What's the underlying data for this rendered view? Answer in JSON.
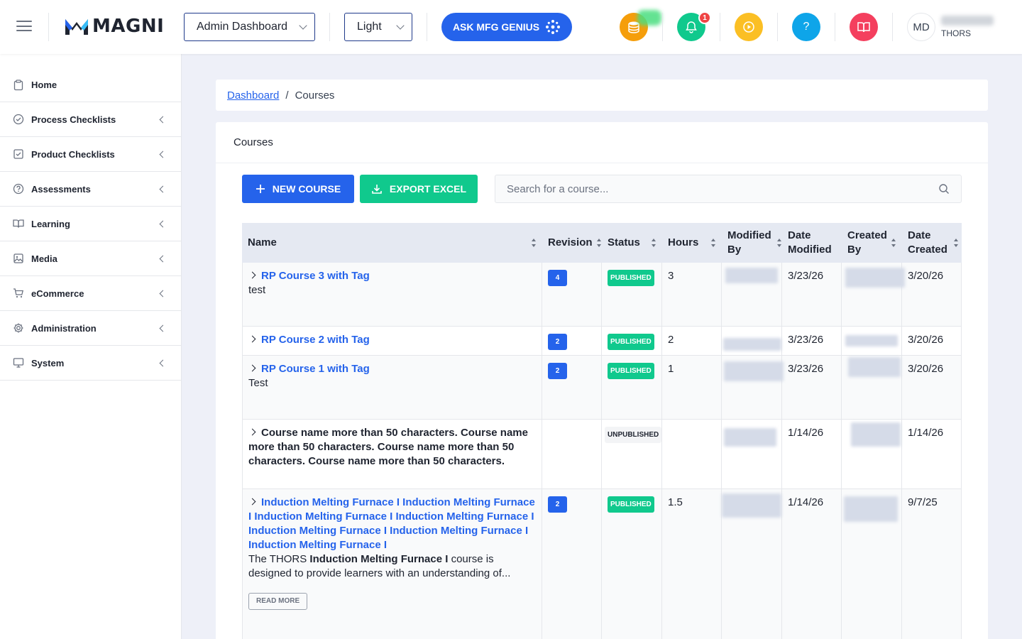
{
  "header": {
    "logo_text": "MAGNI",
    "dashboard_select": "Admin Dashboard",
    "theme_select": "Light",
    "ask_button": "ASK MFG GENIUS",
    "notification_count": "1",
    "help_label": "?",
    "user_initials": "MD",
    "user_org": "THORS"
  },
  "sidebar": {
    "items": [
      {
        "label": "Home",
        "icon": "clipboard-icon"
      },
      {
        "label": "Process Checklists",
        "icon": "check-circle-icon"
      },
      {
        "label": "Product Checklists",
        "icon": "check-square-icon"
      },
      {
        "label": "Assessments",
        "icon": "question-circle-icon"
      },
      {
        "label": "Learning",
        "icon": "book-icon"
      },
      {
        "label": "Media",
        "icon": "image-icon"
      },
      {
        "label": "eCommerce",
        "icon": "cart-icon"
      },
      {
        "label": "Administration",
        "icon": "gear-icon"
      },
      {
        "label": "System",
        "icon": "monitor-icon"
      }
    ]
  },
  "breadcrumb": {
    "link": "Dashboard",
    "separator": "/",
    "current": "Courses"
  },
  "page": {
    "card_title": "Courses",
    "new_course": "NEW COURSE",
    "export_excel": "EXPORT EXCEL",
    "search_placeholder": "Search for a course..."
  },
  "table": {
    "columns": [
      "Name",
      "Revision",
      "Status",
      "Hours",
      "Modified By",
      "Date Modified",
      "Created By",
      "Date Created"
    ],
    "rows": [
      {
        "name": "RP Course 3 with Tag",
        "desc": "test",
        "revision": "4",
        "status": "PUBLISHED",
        "hours": "3",
        "date_modified": "3/23/26",
        "date_created": "3/20/26"
      },
      {
        "name": "RP Course 2 with Tag",
        "desc": "",
        "revision": "2",
        "status": "PUBLISHED",
        "hours": "2",
        "date_modified": "3/23/26",
        "date_created": "3/20/26"
      },
      {
        "name": "RP Course 1 with Tag",
        "desc": "Test",
        "revision": "2",
        "status": "PUBLISHED",
        "hours": "1",
        "date_modified": "3/23/26",
        "date_created": "3/20/26"
      },
      {
        "name": "Course name more than 50 characters. Course name more than 50 characters. Course name more than 50 characters. Course name more than 50 characters.",
        "desc": "",
        "revision": "",
        "status": "UNPUBLISHED",
        "hours": "",
        "date_modified": "1/14/26",
        "date_created": "1/14/26"
      },
      {
        "name": "Induction Melting Furnace I Induction Melting Furnace I Induction Melting Furnace I Induction Melting Furnace I Induction Melting Furnace I Induction Melting Furnace I Induction Melting Furnace I",
        "desc_pre": "The THORS ",
        "desc_bold": "Induction Melting Furnace I",
        "desc_post": " course is designed to provide learners with an understanding of...",
        "read_more": "READ MORE",
        "revision": "2",
        "status": "PUBLISHED",
        "hours": "1.5",
        "date_modified": "1/14/26",
        "date_created": "9/7/25"
      }
    ]
  },
  "colors": {
    "primary": "#2563eb",
    "success": "#10c98d",
    "coins": "#f59e0b",
    "bell": "#10c98d",
    "play": "#fbbf24",
    "help": "#0ea5e9",
    "book": "#f43f5e"
  }
}
